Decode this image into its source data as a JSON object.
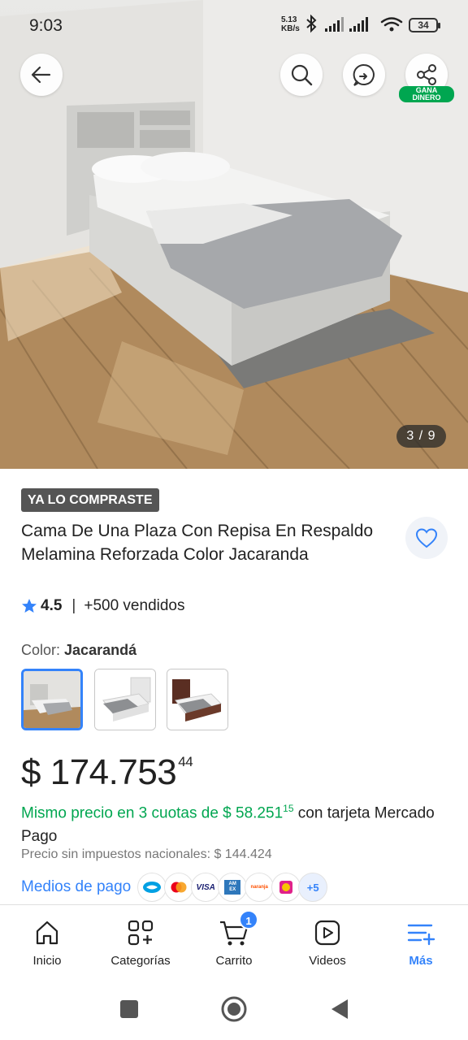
{
  "status_bar": {
    "time": "9:03",
    "net_speed_value": "5.13",
    "net_speed_unit": "KB/s",
    "battery": "34"
  },
  "hero": {
    "image_counter": "3 / 9",
    "share_badge_line1": "GANA",
    "share_badge_line2": "DINERO"
  },
  "product": {
    "purchased_badge": "YA LO COMPRASTE",
    "title": "Cama De Una Plaza Con Repisa En Respaldo Melamina Reforzada Color Jacaranda",
    "rating": "4.5",
    "separator": "|",
    "sold": "+500 vendidos",
    "color_label": "Color:",
    "color_value": "Jacarandá",
    "price_currency": "$",
    "price_main": "174.753",
    "price_cents": "44",
    "installments_prefix": "Mismo precio en 3 cuotas de $ 58.251",
    "installments_cents": "15",
    "installments_suffix": "con tarjeta Mercado Pago",
    "tax_text": "Precio sin impuestos nacionales: $ 144.424",
    "payment_label": "Medios de pago",
    "payment_icons": [
      "mercadopago-icon",
      "mastercard-icon",
      "visa-icon",
      "amex-icon",
      "naranja-icon",
      "cabal-icon"
    ],
    "payment_visa": "VISA",
    "payment_amex": "AM EX",
    "payment_naranja": "naranja",
    "payment_more": "+5"
  },
  "bottom_nav": {
    "items": [
      {
        "label": "Inicio",
        "icon": "home-icon"
      },
      {
        "label": "Categorías",
        "icon": "categories-icon"
      },
      {
        "label": "Carrito",
        "icon": "cart-icon"
      },
      {
        "label": "Videos",
        "icon": "videos-icon"
      },
      {
        "label": "Más",
        "icon": "menu-plus-icon"
      }
    ],
    "cart_count": "1"
  },
  "colors": {
    "accent_blue": "#3483fa",
    "green": "#00a650",
    "badge_gray": "#555555"
  }
}
